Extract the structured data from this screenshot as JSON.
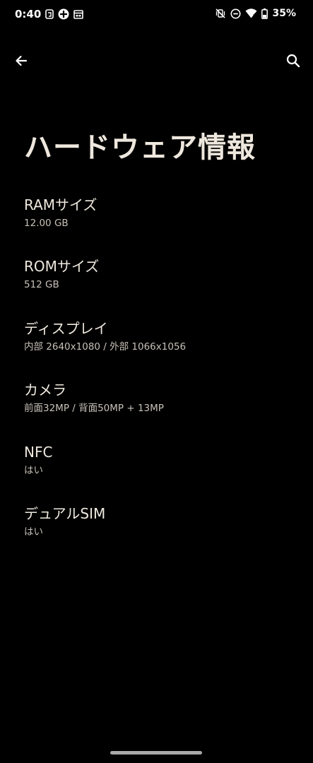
{
  "status_bar": {
    "time": "0:40",
    "battery": "35%",
    "left_icons": [
      "app-icon",
      "game-icon",
      "calendar-icon"
    ],
    "right_icons": [
      "mute-vibrate-icon",
      "do-not-disturb-icon",
      "wifi-icon",
      "battery-icon"
    ]
  },
  "app_bar": {
    "back_icon": "arrow-back-icon",
    "search_icon": "search-icon"
  },
  "page": {
    "title": "ハードウェア情報"
  },
  "items": [
    {
      "label": "RAMサイズ",
      "value": "12.00 GB"
    },
    {
      "label": "ROMサイズ",
      "value": "512 GB"
    },
    {
      "label": "ディスプレイ",
      "value": "内部 2640x1080 / 外部 1066x1056"
    },
    {
      "label": "カメラ",
      "value": "前面32MP / 背面50MP + 13MP"
    },
    {
      "label": "NFC",
      "value": "はい"
    },
    {
      "label": "デュアルSIM",
      "value": "はい"
    }
  ],
  "colors": {
    "background": "#000000",
    "text_primary": "#efe9df",
    "text_secondary": "#c7c1b8"
  }
}
